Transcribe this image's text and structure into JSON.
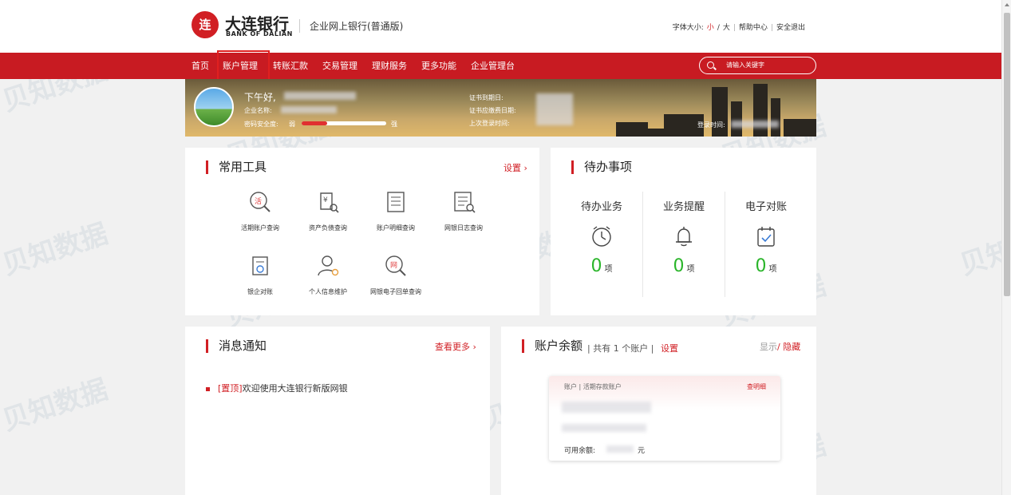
{
  "watermark": "贝知数据",
  "brand": {
    "logo_glyph": "连",
    "name_cn": "大连银行",
    "name_en": "BANK OF DALIAN",
    "system": "企业网上银行(普通版)"
  },
  "top_links": {
    "font_label": "字体大小:",
    "small": "小",
    "slash": "/",
    "large": "大",
    "divider": "|",
    "help": "帮助中心",
    "logout": "安全退出"
  },
  "nav": {
    "items": [
      "首页",
      "账户管理",
      "转账汇款",
      "交易管理",
      "理财服务",
      "更多功能",
      "企业管理台"
    ],
    "search_placeholder": "请输入关键字"
  },
  "banner": {
    "greeting": "下午好,",
    "company_label": "企业名称:",
    "pwd_label": "密码安全度:",
    "weak": "弱",
    "strong": "强",
    "pwd_strength": 0.3,
    "cert_expiry_label": "证书到期日:",
    "cert_fee_label": "证书应缴费日期:",
    "last_login_label": "上次登录时间:",
    "login_time_label": "登录时间:"
  },
  "tools": {
    "title": "常用工具",
    "settings": "设置",
    "items": [
      {
        "label": "活期账户查询",
        "icon": "current-account-query-icon"
      },
      {
        "label": "资产负债查询",
        "icon": "asset-liability-query-icon"
      },
      {
        "label": "账户明细查询",
        "icon": "account-detail-query-icon"
      },
      {
        "label": "网银日志查询",
        "icon": "ebank-log-query-icon"
      },
      {
        "label": "银企对账",
        "icon": "bank-enterprise-reconcile-icon"
      },
      {
        "label": "个人信息维护",
        "icon": "personal-info-icon"
      },
      {
        "label": "网银电子回单查询",
        "icon": "e-receipt-query-icon"
      }
    ]
  },
  "todo": {
    "title": "待办事项",
    "unit": "项",
    "items": [
      {
        "label": "待办业务",
        "count": "0",
        "icon": "clock-icon"
      },
      {
        "label": "业务提醒",
        "count": "0",
        "icon": "bell-icon"
      },
      {
        "label": "电子对账",
        "count": "0",
        "icon": "calendar-check-icon"
      }
    ]
  },
  "messages": {
    "title": "消息通知",
    "more": "查看更多",
    "items": [
      {
        "tag": "[置顶]",
        "text": "欢迎使用大连银行新版网银"
      }
    ]
  },
  "balance": {
    "title": "账户余额",
    "count_text": "| 共有 1 个账户 |",
    "settings": "设置",
    "show": "显示",
    "hide": "隐藏",
    "card_label": "账户 | 活期存款账户",
    "card_link": "查明细",
    "available_label": "可用余额:",
    "currency": "元"
  },
  "colors": {
    "brand_red": "#c81b22",
    "count_green": "#2ab52a"
  }
}
